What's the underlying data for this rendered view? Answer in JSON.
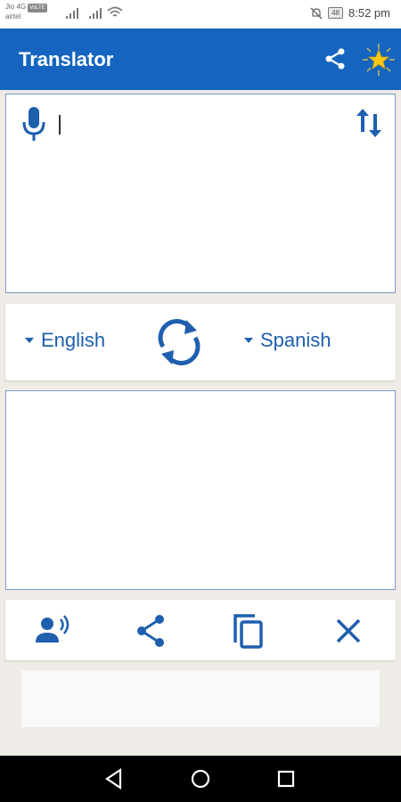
{
  "status_bar": {
    "carrier_1": "Jio 4G",
    "volte_badge": "VoLTE",
    "carrier_2": "airtel",
    "battery": "48",
    "time": "8:52 pm"
  },
  "app_bar": {
    "title": "Translator",
    "share_icon": "share-icon",
    "rate_icon": "star-icon"
  },
  "source_panel": {
    "input_value": "",
    "mic_icon": "microphone-icon",
    "swap_icon": "swap-vertical-icon"
  },
  "language_bar": {
    "source_language": "English",
    "target_language": "Spanish",
    "swap_icon": "sync-icon"
  },
  "target_panel": {
    "output_value": ""
  },
  "actions": {
    "speak_icon": "speak-icon",
    "share_icon": "share-icon",
    "copy_icon": "copy-icon",
    "clear_icon": "close-icon"
  },
  "nav_bar": {
    "back_icon": "back-icon",
    "home_icon": "home-icon",
    "recent_icon": "recent-apps-icon"
  },
  "colors": {
    "primary": "#1565c0",
    "accent_text": "#1e5fae",
    "background": "#efebe7"
  }
}
